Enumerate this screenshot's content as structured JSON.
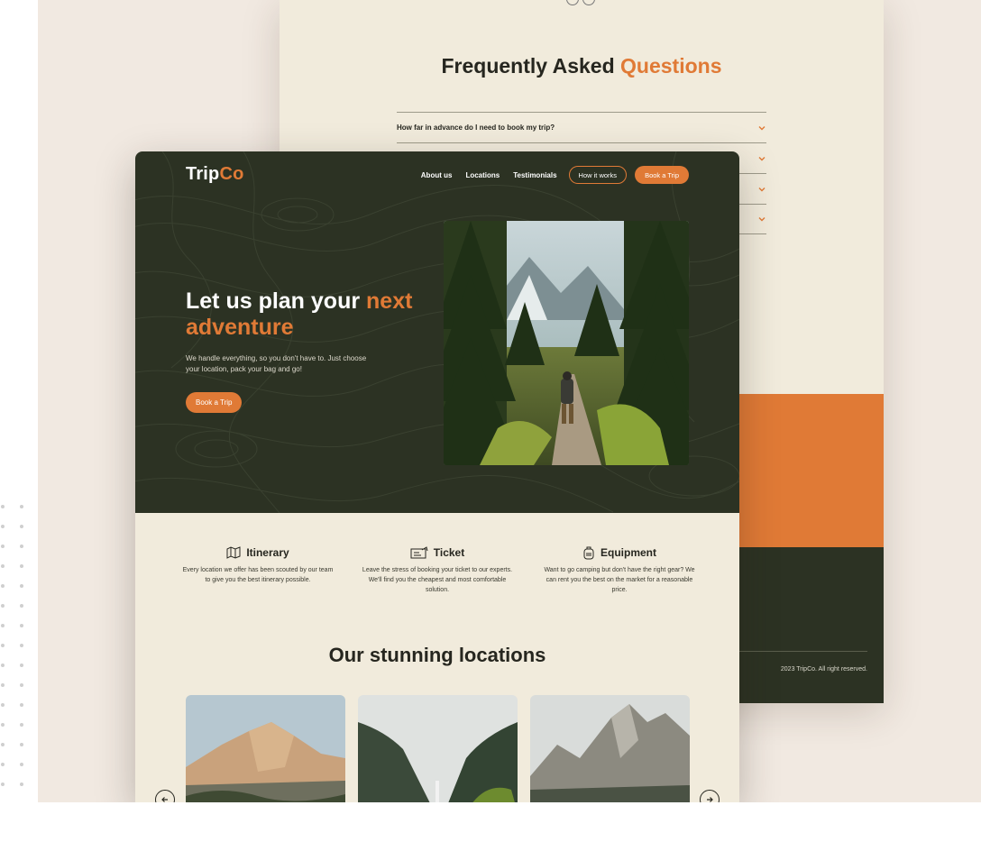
{
  "faq": {
    "title_main": "Frequently Asked ",
    "title_accent": "Questions",
    "items": [
      "How far in advance do I need to book my trip?",
      "",
      "",
      ""
    ]
  },
  "footer": {
    "copyright": "2023 TripCo. All right reserved."
  },
  "brand": {
    "logo_main": "Trip",
    "logo_accent": "Co"
  },
  "nav": {
    "about": "About us",
    "locations": "Locations",
    "testimonials": "Testimonials",
    "how_it_works": "How it works",
    "book": "Book a Trip"
  },
  "hero": {
    "title_main": "Let us plan your ",
    "title_accent": "next adventure",
    "description": "We handle everything, so you don't have to. Just choose your location, pack your bag and go!",
    "cta": "Book a Trip"
  },
  "features": [
    {
      "title": "Itinerary",
      "icon": "map-icon",
      "description": "Every location we offer has been scouted by our team to give you the best itinerary possible."
    },
    {
      "title": "Ticket",
      "icon": "ticket-icon",
      "description": "Leave the stress of booking your ticket to our experts. We'll find you the cheapest and most comfortable solution."
    },
    {
      "title": "Equipment",
      "icon": "backpack-icon",
      "description": "Want to go camping but don't have the right gear? We can rent you the best on the market for a reasonable price."
    }
  ],
  "locations": {
    "title": "Our stunning locations",
    "prev_icon": "arrow-left-icon",
    "next_icon": "arrow-right-icon"
  },
  "colors": {
    "accent": "#e07a36",
    "dark": "#2c3223",
    "cream": "#f1ebdc",
    "backdrop": "#f1e9e1"
  }
}
